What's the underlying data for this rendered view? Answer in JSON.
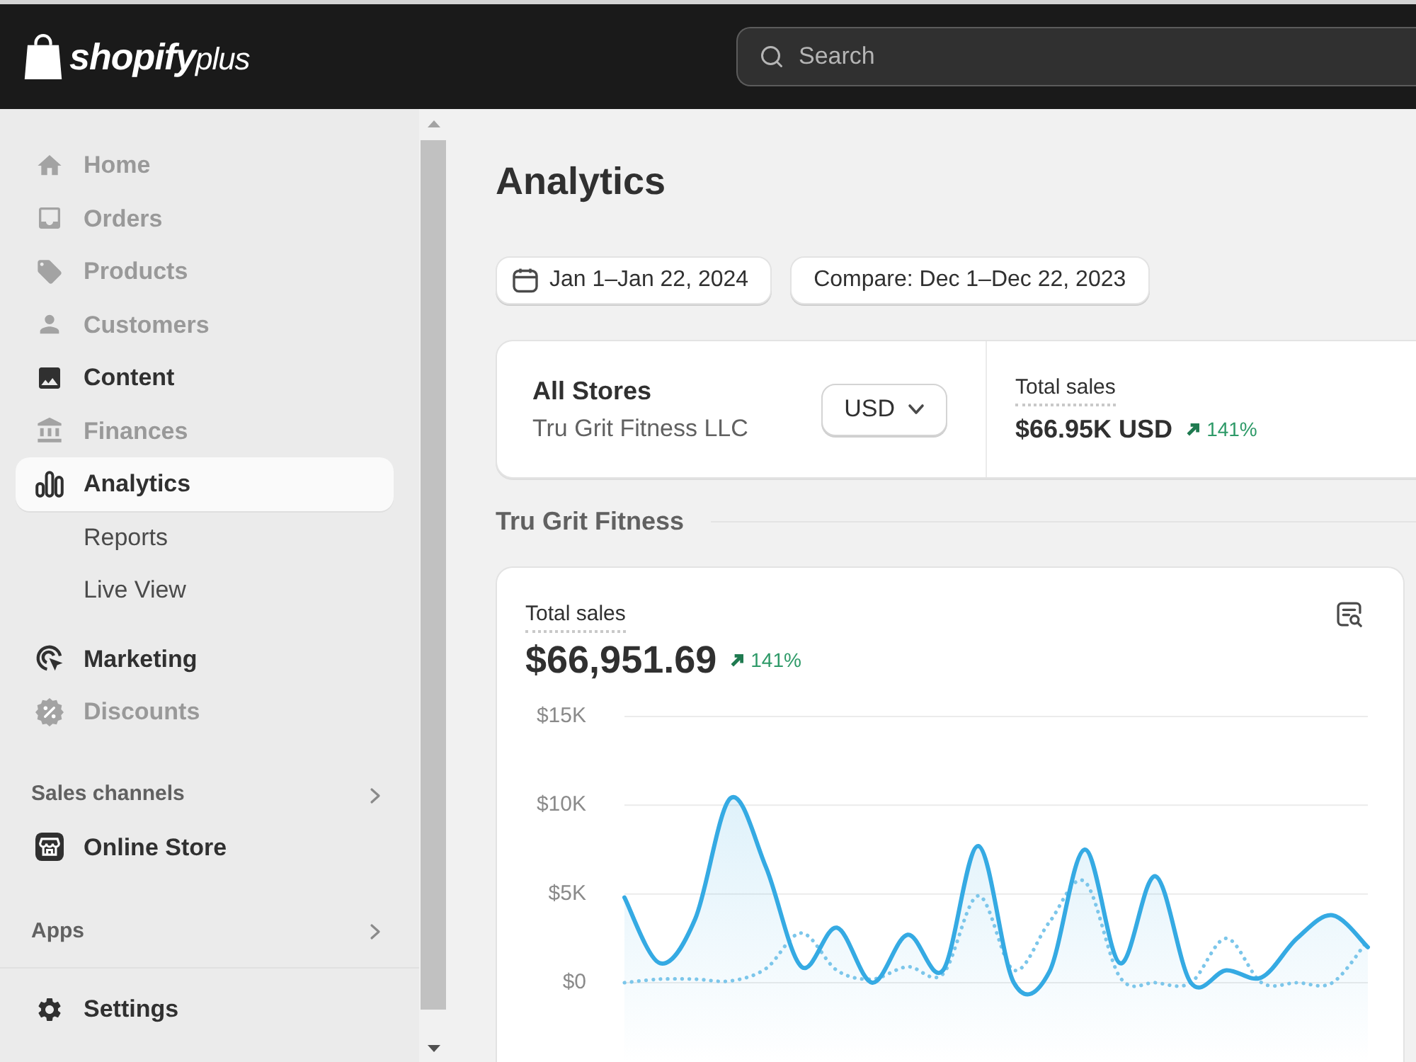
{
  "topbar": {
    "logo": {
      "wordmark": "shopify",
      "suffix": "plus"
    },
    "search": {
      "placeholder": "Search"
    }
  },
  "sidebar": {
    "items": [
      {
        "label": "Home",
        "selected": false,
        "disabled": true
      },
      {
        "label": "Orders",
        "selected": false,
        "disabled": true
      },
      {
        "label": "Products",
        "selected": false,
        "disabled": true
      },
      {
        "label": "Customers",
        "selected": false,
        "disabled": true
      },
      {
        "label": "Content",
        "selected": false,
        "disabled": false
      },
      {
        "label": "Finances",
        "selected": false,
        "disabled": true
      },
      {
        "label": "Analytics",
        "selected": true,
        "disabled": false,
        "children": [
          {
            "label": "Reports",
            "selected": false,
            "disabled": false
          },
          {
            "label": "Live View",
            "selected": false,
            "disabled": false
          }
        ]
      },
      {
        "label": "Marketing",
        "selected": false,
        "disabled": false
      },
      {
        "label": "Discounts",
        "selected": false,
        "disabled": true
      }
    ],
    "sections": [
      {
        "title": "Sales channels",
        "items": [
          {
            "label": "Online Store",
            "selected": false,
            "disabled": false
          }
        ]
      },
      {
        "title": "Apps"
      }
    ],
    "footer_item": {
      "label": "Settings",
      "selected": false,
      "disabled": false
    }
  },
  "page": {
    "title": "Analytics",
    "date_range": "Jan 1–Jan 22, 2024",
    "compare_range": "Compare: Dec 1–Dec 22, 2023"
  },
  "store_summary": {
    "name": "All Stores",
    "company": "Tru Grit Fitness LLC",
    "currency": "USD",
    "metric": {
      "label": "Total sales",
      "value": "$66.95K USD",
      "change": {
        "value": "141%",
        "increase": true
      }
    }
  },
  "store_section": {
    "title": "Tru Grit Fitness",
    "card": {
      "metric": {
        "label": "Total sales",
        "value": "$66,951.69",
        "change": {
          "value": "141%",
          "increase": true
        }
      },
      "chart_data": {
        "type": "line",
        "grid": true,
        "ylim": [
          0,
          15000
        ],
        "yticks": [
          {
            "value": 0,
            "label": "$0"
          },
          {
            "value": 5000,
            "label": "$5K"
          },
          {
            "value": 10000,
            "label": "$10K"
          },
          {
            "value": 15000,
            "label": "$15K"
          }
        ],
        "series": [
          {
            "type": "area",
            "line_style": "solid",
            "color": "#35aae3",
            "values": [
              4800,
              1100,
              3600,
              10400,
              6500,
              900,
              3100,
              0,
              2700,
              700,
              7700,
              0,
              600,
              7500,
              1100,
              6000,
              0,
              700,
              300,
              2500,
              3800,
              2000
            ]
          },
          {
            "type": "line",
            "line_style": "dotted",
            "color": "#7cc6ea",
            "values": [
              0,
              200,
              200,
              100,
              800,
              2800,
              700,
              200,
              900,
              500,
              4900,
              700,
              3400,
              5700,
              300,
              0,
              0,
              2500,
              0,
              0,
              0,
              2400
            ]
          }
        ]
      }
    }
  }
}
